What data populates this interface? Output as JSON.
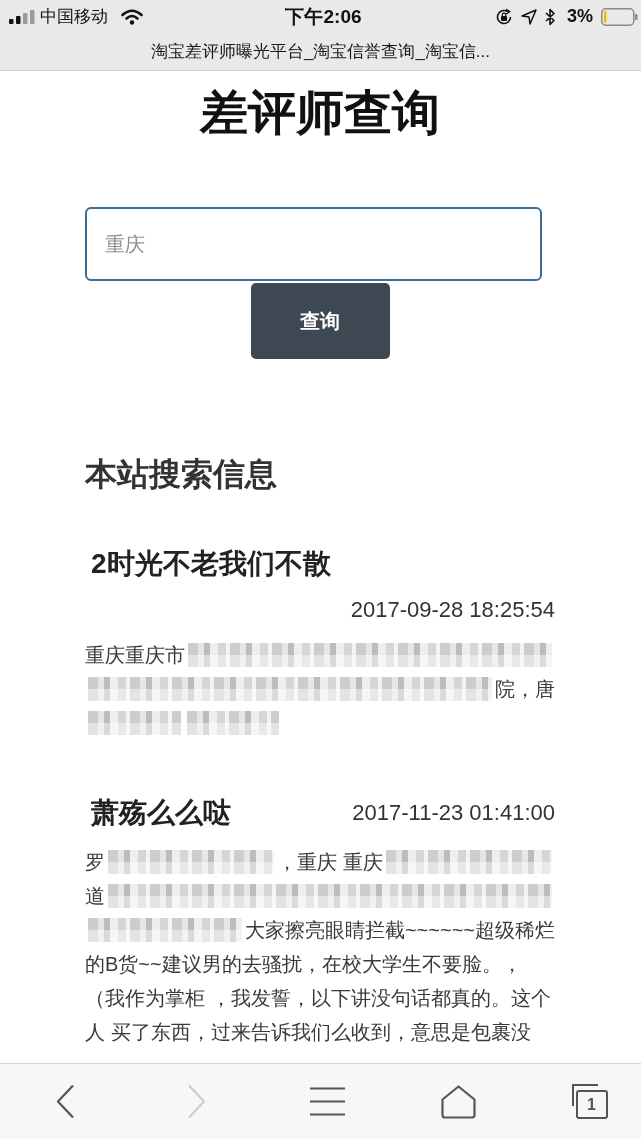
{
  "status_bar": {
    "carrier": "中国移动",
    "time": "下午2:06",
    "battery": "3%"
  },
  "address_bar": {
    "title": "淘宝差评师曝光平台_淘宝信誉查询_淘宝信..."
  },
  "page": {
    "heading": "差评师查询",
    "search": {
      "placeholder": "重庆",
      "button": "查询"
    },
    "section_title": "本站搜索信息",
    "records": [
      {
        "name": "2时光不老我们不散",
        "date": "2017-09-28 18:25:54",
        "lines": [
          [
            {
              "kind": "text",
              "text": "重庆重庆市"
            },
            {
              "kind": "redacted"
            }
          ],
          [
            {
              "kind": "redacted"
            },
            {
              "kind": "text",
              "text": "院，唐"
            }
          ],
          [
            {
              "kind": "redacted"
            },
            {
              "kind": "redacted"
            }
          ]
        ]
      },
      {
        "name": "萧殇么么哒",
        "date": "2017-11-23 01:41:00",
        "lines": [
          [
            {
              "kind": "text",
              "text": "罗"
            },
            {
              "kind": "redacted"
            },
            {
              "kind": "text",
              "text": "，重庆 重庆"
            },
            {
              "kind": "redacted"
            }
          ],
          [
            {
              "kind": "text",
              "text": "道"
            },
            {
              "kind": "redacted"
            }
          ],
          [
            {
              "kind": "redacted"
            },
            {
              "kind": "text",
              "text": "大家擦亮眼睛拦截~~~~~~超级稀烂"
            }
          ],
          [
            {
              "kind": "text",
              "text": "的B货~~建议男的去骚扰，在校大学生不要脸。，"
            }
          ],
          [
            {
              "kind": "text",
              "text": "（我作为掌柜 ，我发誓，以下讲没句话都真的。这个"
            }
          ],
          [
            {
              "kind": "text",
              "text": "人 买了东西，过来告诉我们么收到，意思是包裹没"
            }
          ]
        ]
      }
    ]
  },
  "toolbar": {
    "items": [
      {
        "kind": "back",
        "disabled": false
      },
      {
        "kind": "forward",
        "disabled": true
      },
      {
        "kind": "menu",
        "disabled": false
      },
      {
        "kind": "home",
        "disabled": false
      },
      {
        "kind": "tabs",
        "count": "1",
        "disabled": false
      }
    ]
  }
}
